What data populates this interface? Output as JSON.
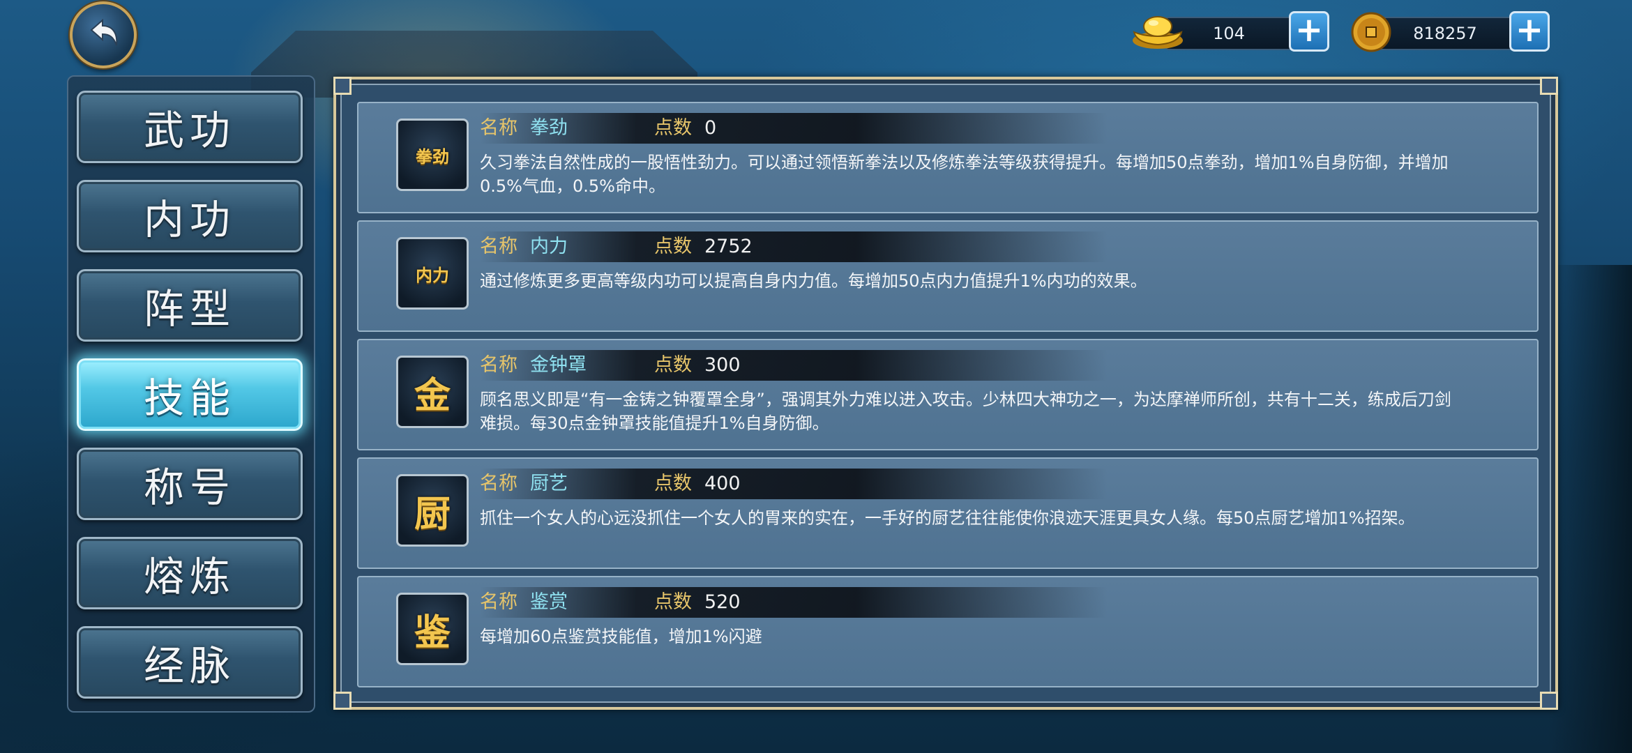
{
  "header": {
    "back_button_label": "back"
  },
  "currency": {
    "gold": {
      "icon": "gold-ingot-icon",
      "value": "104"
    },
    "copper": {
      "icon": "copper-coin-icon",
      "value": "818257"
    }
  },
  "menu": {
    "items": [
      {
        "label": "武功",
        "active": false
      },
      {
        "label": "内功",
        "active": false
      },
      {
        "label": "阵型",
        "active": false
      },
      {
        "label": "技能",
        "active": true
      },
      {
        "label": "称号",
        "active": false
      },
      {
        "label": "熔炼",
        "active": false
      },
      {
        "label": "经脉",
        "active": false
      }
    ]
  },
  "skills": {
    "name_label": "名称",
    "points_label": "点数",
    "rows": [
      {
        "icon_text": "拳劲",
        "name": "拳劲",
        "points": "0",
        "description": "久习拳法自然性成的一股悟性劲力。可以通过领悟新拳法以及修炼拳法等级获得提升。每增加50点拳劲，增加1%自身防御，并增加0.5%气血，0.5%命中。"
      },
      {
        "icon_text": "内力",
        "name": "内力",
        "points": "2752",
        "description": "通过修炼更多更高等级内功可以提高自身内力值。每增加50点内力值提升1%内功的效果。"
      },
      {
        "icon_text": "金",
        "name": "金钟罩",
        "points": "300",
        "description": "顾名思义即是“有一金铸之钟覆罩全身”，强调其外力难以进入攻击。少林四大神功之一，为达摩禅师所创，共有十二关，练成后刀剑难损。每30点金钟罩技能值提升1%自身防御。"
      },
      {
        "icon_text": "厨",
        "name": "厨艺",
        "points": "400",
        "description": "抓住一个女人的心远没抓住一个女人的胃来的实在，一手好的厨艺往往能使你浪迹天涯更具女人缘。每50点厨艺增加1%招架。"
      },
      {
        "icon_text": "鉴",
        "name": "鉴赏",
        "points": "520",
        "description": "每增加60点鉴赏技能值，增加1%闪避"
      }
    ]
  }
}
